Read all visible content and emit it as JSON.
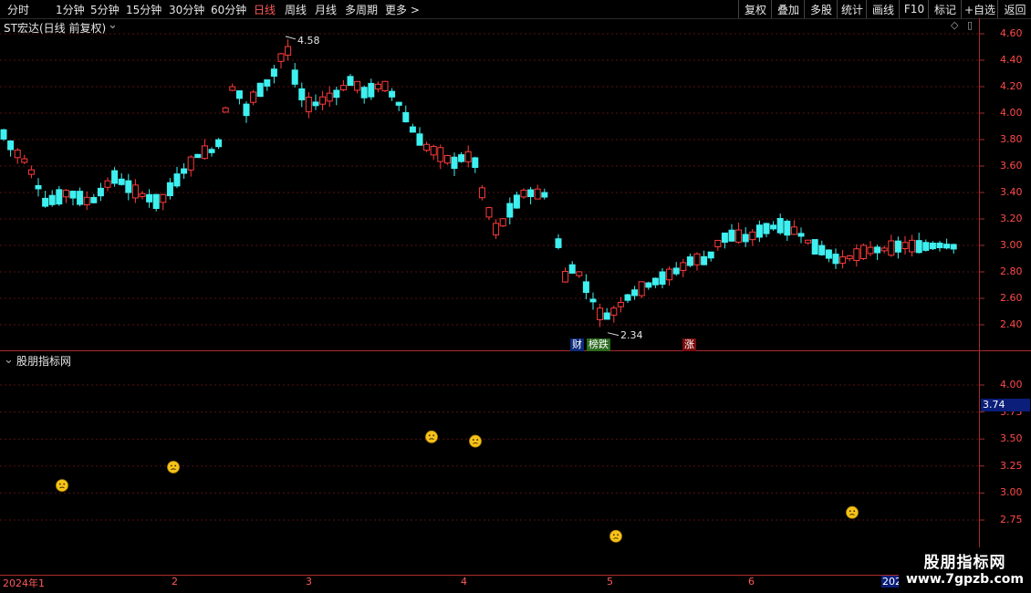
{
  "toolbar": {
    "periods": [
      "分时",
      "1分钟",
      "5分钟",
      "15分钟",
      "30分钟",
      "60分钟",
      "日线",
      "周线",
      "月线",
      "多周期",
      "更多 >"
    ],
    "active_period": "日线",
    "actions": [
      "复权",
      "叠加",
      "多股",
      "统计",
      "画线",
      "F10",
      "标记",
      "+自选",
      "返回"
    ]
  },
  "main_panel": {
    "title": "ST宏达(日线 前复权)",
    "high_label": "4.58",
    "low_label": "2.34",
    "tags": [
      "财",
      "榜跌",
      "涨"
    ],
    "y_ticks": [
      "4.60",
      "4.40",
      "4.20",
      "4.00",
      "3.80",
      "3.60",
      "3.40",
      "3.20",
      "3.00",
      "2.80",
      "2.60",
      "2.40"
    ],
    "colors": {
      "up": "#ff3b3b",
      "down": "#3ff0f0",
      "grid": "#5a1010"
    }
  },
  "indicator_panel": {
    "title": "股朋指标网",
    "y_ticks": [
      "4.00",
      "3.75",
      "3.50",
      "3.25",
      "3.00",
      "2.75"
    ],
    "current_value": "3.74",
    "emoji_points": [
      3.07,
      3.24,
      3.52,
      3.48,
      2.6,
      2.82
    ]
  },
  "x_axis": {
    "labels": [
      "2024年1",
      "2",
      "3",
      "4",
      "5",
      "6",
      "202"
    ]
  },
  "watermark": {
    "title": "股朋指标网",
    "url": "www.7gpzb.com"
  }
}
